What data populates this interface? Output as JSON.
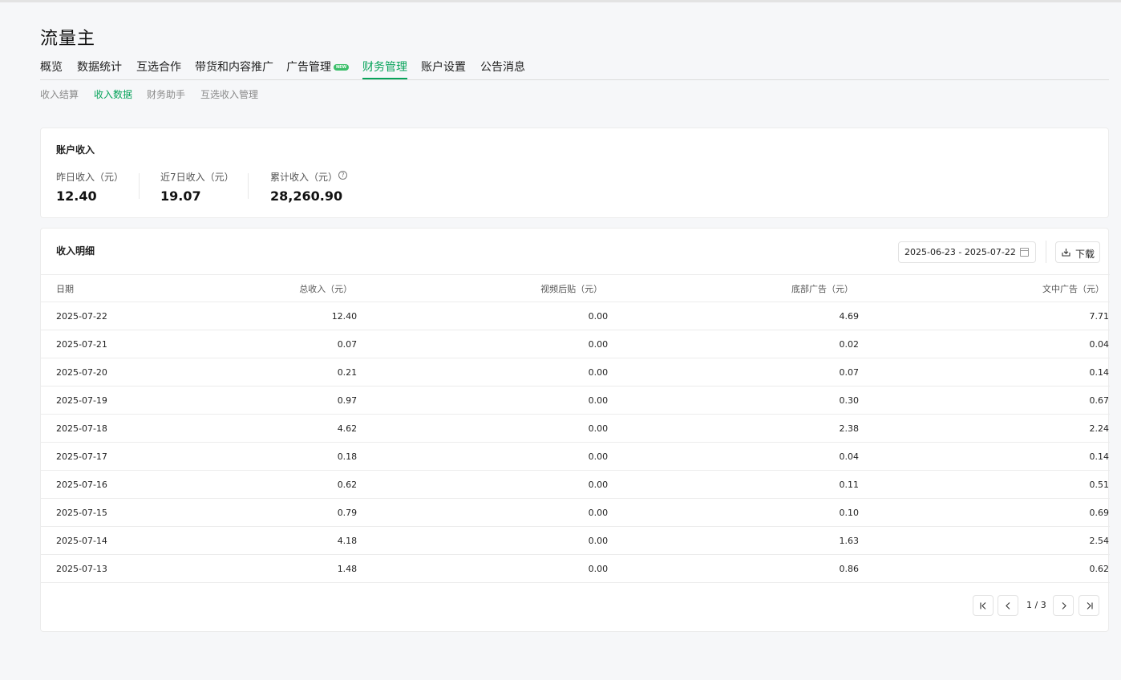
{
  "app": {
    "title": "流量主"
  },
  "main_tabs": [
    {
      "label": "概览"
    },
    {
      "label": "数据统计"
    },
    {
      "label": "互选合作"
    },
    {
      "label": "带货和内容推广"
    },
    {
      "label": "广告管理",
      "badge": "NEW"
    },
    {
      "label": "财务管理",
      "active": true
    },
    {
      "label": "账户设置"
    },
    {
      "label": "公告消息"
    }
  ],
  "sub_tabs": [
    {
      "label": "收入结算"
    },
    {
      "label": "收入数据",
      "active": true
    },
    {
      "label": "财务助手"
    },
    {
      "label": "互选收入管理"
    }
  ],
  "account_income": {
    "title": "账户收入",
    "stats": [
      {
        "label": "昨日收入（元）",
        "value": "12.40"
      },
      {
        "label": "近7日收入（元）",
        "value": "19.07"
      },
      {
        "label": "累计收入（元）",
        "value": "28,260.90",
        "help_icon": "question-circle-icon"
      }
    ]
  },
  "income_detail": {
    "title": "收入明细",
    "date_range": "2025-06-23 - 2025-07-22",
    "download_label": "下载",
    "columns": [
      "日期",
      "总收入（元）",
      "视频后贴（元）",
      "底部广告（元）",
      "文中广告（元）"
    ],
    "rows": [
      [
        "2025-07-22",
        "12.40",
        "0.00",
        "4.69",
        "7.71"
      ],
      [
        "2025-07-21",
        "0.07",
        "0.00",
        "0.02",
        "0.04"
      ],
      [
        "2025-07-20",
        "0.21",
        "0.00",
        "0.07",
        "0.14"
      ],
      [
        "2025-07-19",
        "0.97",
        "0.00",
        "0.30",
        "0.67"
      ],
      [
        "2025-07-18",
        "4.62",
        "0.00",
        "2.38",
        "2.24"
      ],
      [
        "2025-07-17",
        "0.18",
        "0.00",
        "0.04",
        "0.14"
      ],
      [
        "2025-07-16",
        "0.62",
        "0.00",
        "0.11",
        "0.51"
      ],
      [
        "2025-07-15",
        "0.79",
        "0.00",
        "0.10",
        "0.69"
      ],
      [
        "2025-07-14",
        "4.18",
        "0.00",
        "1.63",
        "2.54"
      ],
      [
        "2025-07-13",
        "1.48",
        "0.00",
        "0.86",
        "0.62"
      ]
    ],
    "pagination": {
      "text": "1 / 3"
    }
  },
  "colors": {
    "accent": "#07a35a",
    "badge": "#3cbf6a"
  }
}
